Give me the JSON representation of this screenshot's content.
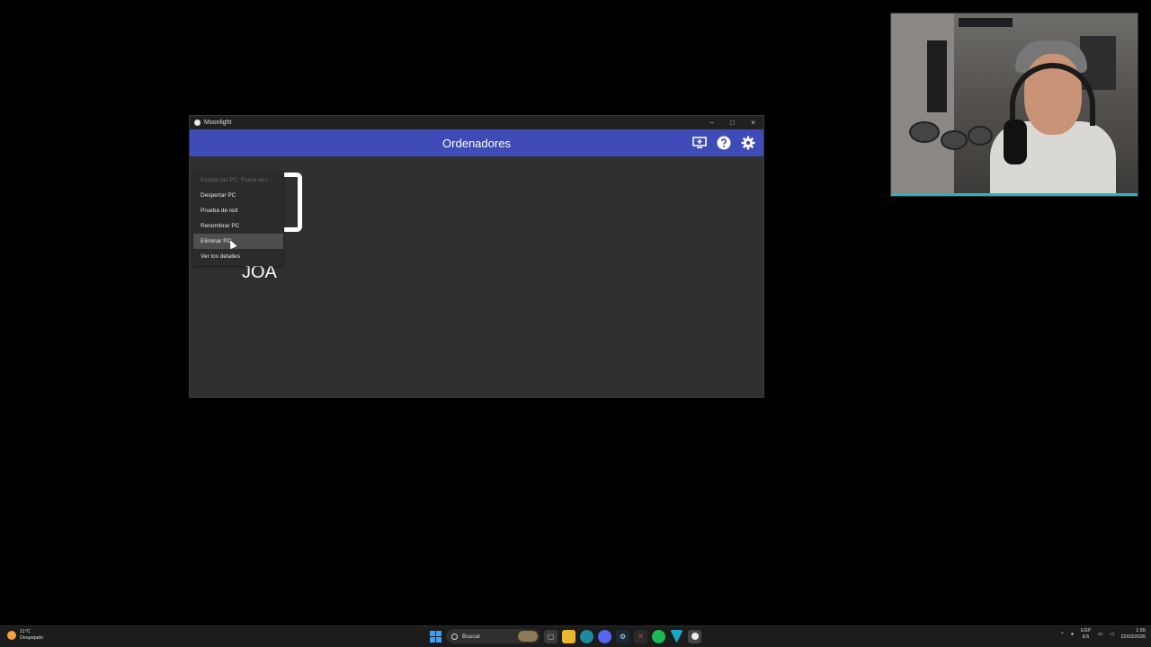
{
  "window": {
    "title": "Moonlight",
    "controls": {
      "minimize": "–",
      "maximize": "□",
      "close": "×"
    }
  },
  "toolbar": {
    "title": "Ordenadores",
    "icons": [
      "add-pc-icon",
      "help-icon",
      "settings-icon"
    ]
  },
  "pc": {
    "name": "JOA"
  },
  "context_menu": {
    "items": [
      {
        "label": "Estado del PC: Fuera de l...",
        "state": "disabled"
      },
      {
        "label": "Despertar PC",
        "state": "normal"
      },
      {
        "label": "Prueba de red",
        "state": "normal"
      },
      {
        "label": "Renombrar PC",
        "state": "normal"
      },
      {
        "label": "Eliminar PC",
        "state": "hover"
      },
      {
        "label": "Ver los detalles",
        "state": "normal"
      }
    ]
  },
  "taskbar": {
    "weather": {
      "temp": "11°C",
      "desc": "Despejado"
    },
    "search_label": "Buscar",
    "language": {
      "top": "ESP",
      "bottom": "ES"
    },
    "clock": {
      "time": "1:55",
      "date": "22/03/2026"
    }
  },
  "colors": {
    "accent": "#3f4bb6",
    "window_bg": "#303030",
    "menu_hover": "#4e4e4e"
  }
}
